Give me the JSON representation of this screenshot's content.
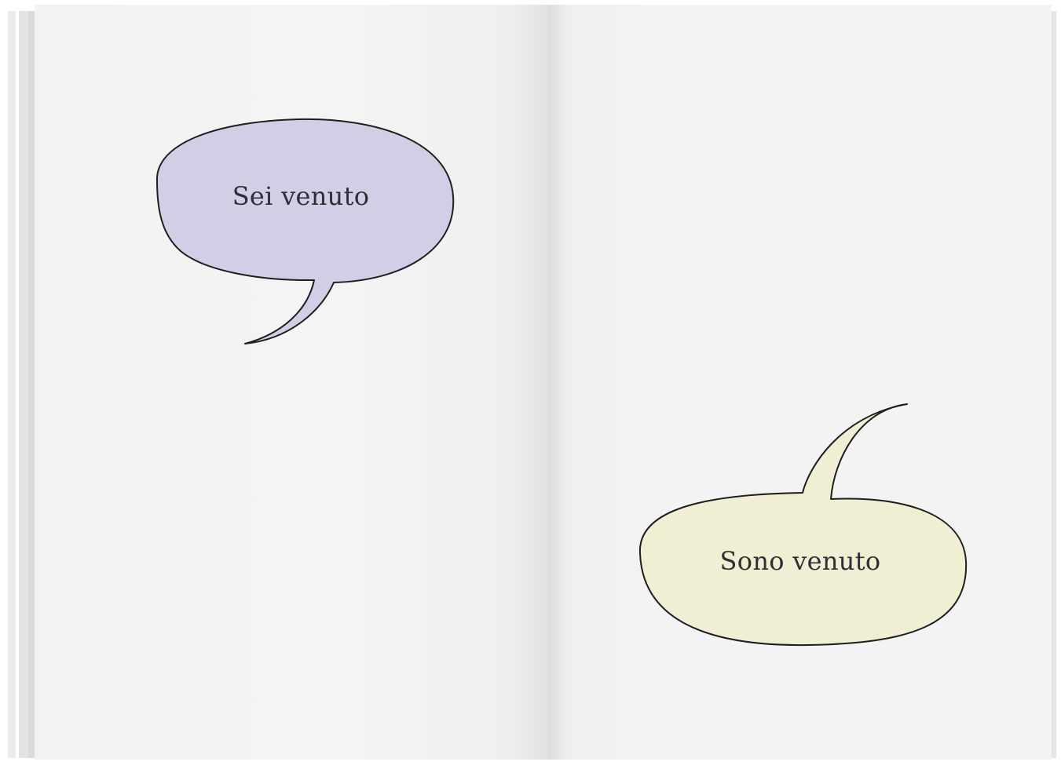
{
  "left_page": {
    "bubble_text": "Sei venuto",
    "bubble_color": "#d1cfe5"
  },
  "right_page": {
    "bubble_text": "Sono venuto",
    "bubble_color": "#f1efd3"
  },
  "colors": {
    "page": "#f4f4f4",
    "outline": "#1e1e1e"
  }
}
